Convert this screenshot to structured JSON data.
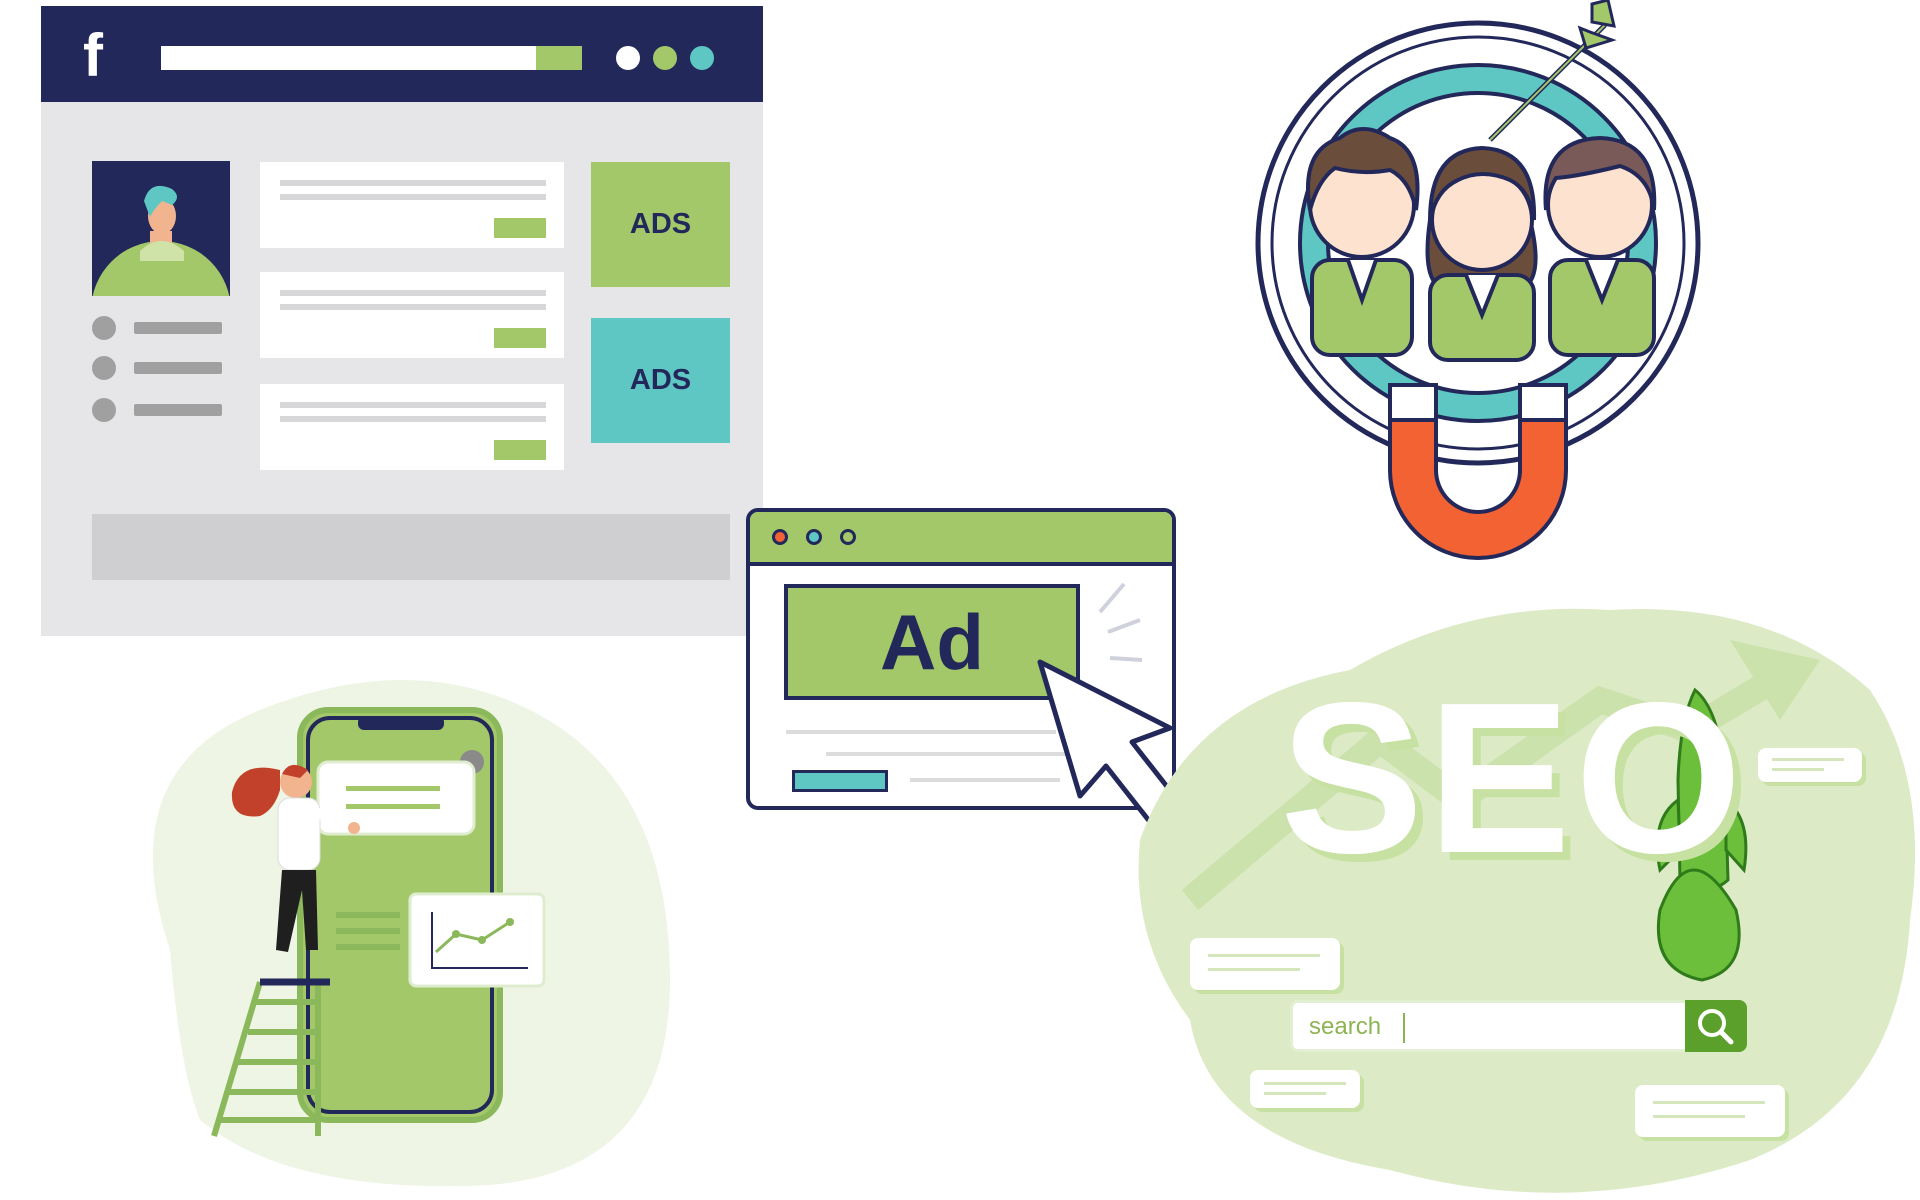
{
  "colors": {
    "navy": "#23285a",
    "green": "#a3c86a",
    "teal": "#5ec7c4",
    "orange": "#f26232",
    "light_green": "#e3efd2",
    "grey": "#e6e6e8"
  },
  "social": {
    "logo_letter": "f",
    "ads": [
      {
        "label": "ADS",
        "color": "#a3c86a"
      },
      {
        "label": "ADS",
        "color": "#5ec7c4"
      }
    ],
    "header_dots": [
      "#ffffff",
      "#a3c86a",
      "#5ec7c4"
    ]
  },
  "ad_window": {
    "ad_label": "Ad",
    "window_dots": [
      "#f26232",
      "#5ec7c4",
      "#a3c86a"
    ]
  },
  "seo": {
    "title": "SEO",
    "search_placeholder": "search"
  },
  "icons": {
    "facebook": "facebook-logo-icon",
    "magnet": "magnet-icon",
    "target": "target-icon",
    "arrow": "arrow-icon",
    "cursor": "cursor-arrow-icon",
    "rocket": "rocket-icon",
    "search": "magnifier-icon",
    "chart": "line-chart-icon",
    "ladder": "ladder-icon"
  }
}
